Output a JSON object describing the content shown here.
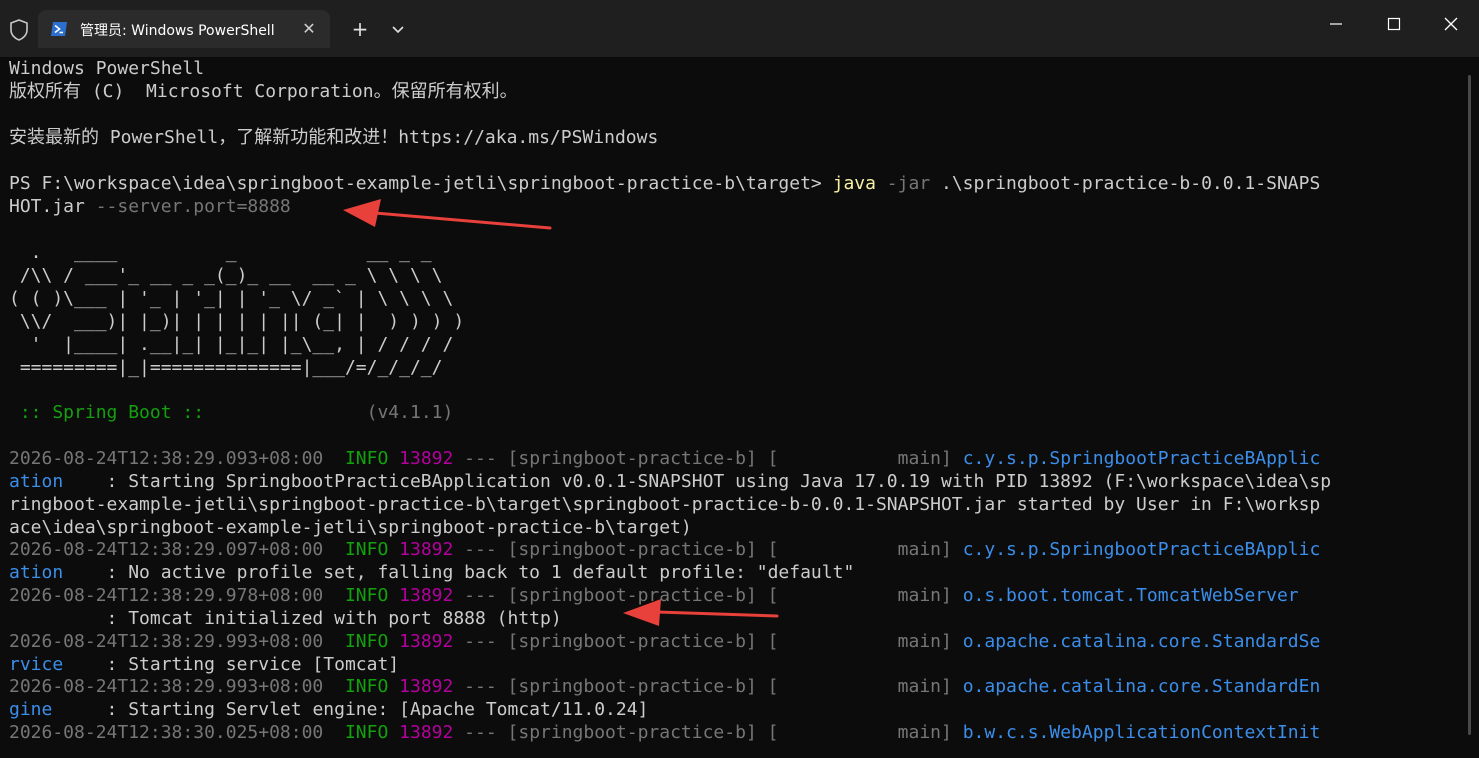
{
  "titlebar": {
    "tab_title": "管理员: Windows PowerShell",
    "close_label": "✕",
    "new_tab_label": "+"
  },
  "terminal": {
    "header": [
      "Windows PowerShell",
      "版权所有 (C)  Microsoft Corporation。保留所有权利。",
      "安装最新的 PowerShell，了解新功能和改进！https://aka.ms/PSWindows"
    ],
    "prompt": {
      "path": "PS F:\\workspace\\idea\\springboot-example-jetli\\springboot-practice-b\\target> ",
      "cmd": "java",
      "flag": " -jar",
      "arg1": " .\\springboot-practice-b-0.0.1-SNAPS",
      "arg1_cont": "HOT.jar",
      "flag2": " --server.port=8888"
    },
    "banner": [
      "  .   ____          _            __ _ _",
      " /\\\\ / ___'_ __ _ _(_)_ __  __ _ \\ \\ \\ \\",
      "( ( )\\___ | '_ | '_| | '_ \\/ _` | \\ \\ \\ \\",
      " \\\\/  ___)| |_)| | | | | || (_| |  ) ) ) )",
      "  '  |____| .__|_| |_|_| |_\\__, | / / / /",
      " =========|_|==============|___/=/_/_/_/"
    ],
    "spring_label": " :: Spring Boot ::",
    "spring_version": "               (v4.1.1)",
    "logs": [
      {
        "time": "2026-08-24T12:38:29.093+08:00",
        "level": "  INFO",
        "pid": " 13892",
        "sep": " --- [springboot-practice-b] [           main] ",
        "logger": "c.y.s.p.SpringbootPracticeBApplic",
        "cont": [
          {
            "logger": "ation",
            "msg": "    : Starting SpringbootPracticeBApplication v0.0.1-SNAPSHOT using Java 17.0.19 with PID 13892 (F:\\workspace\\idea\\sp"
          },
          {
            "logger": "",
            "msg": "ringboot-example-jetli\\springboot-practice-b\\target\\springboot-practice-b-0.0.1-SNAPSHOT.jar started by User in F:\\worksp"
          },
          {
            "logger": "",
            "msg": "ace\\idea\\springboot-example-jetli\\springboot-practice-b\\target)"
          }
        ]
      },
      {
        "time": "2026-08-24T12:38:29.097+08:00",
        "level": "  INFO",
        "pid": " 13892",
        "sep": " --- [springboot-practice-b] [           main] ",
        "logger": "c.y.s.p.SpringbootPracticeBApplic",
        "cont": [
          {
            "logger": "ation",
            "msg": "    : No active profile set, falling back to 1 default profile: \"default\""
          }
        ]
      },
      {
        "time": "2026-08-24T12:38:29.978+08:00",
        "level": "  INFO",
        "pid": " 13892",
        "sep": " --- [springboot-practice-b] [           main] ",
        "logger": "o.s.boot.tomcat.TomcatWebServer",
        "cont": [
          {
            "logger": "",
            "msg": "         : Tomcat initialized with port 8888 (http)"
          }
        ]
      },
      {
        "time": "2026-08-24T12:38:29.993+08:00",
        "level": "  INFO",
        "pid": " 13892",
        "sep": " --- [springboot-practice-b] [           main] ",
        "logger": "o.apache.catalina.core.StandardSe",
        "cont": [
          {
            "logger": "rvice",
            "msg": "    : Starting service [Tomcat]"
          }
        ]
      },
      {
        "time": "2026-08-24T12:38:29.993+08:00",
        "level": "  INFO",
        "pid": " 13892",
        "sep": " --- [springboot-practice-b] [           main] ",
        "logger": "o.apache.catalina.core.StandardEn",
        "cont": [
          {
            "logger": "gine",
            "msg": "     : Starting Servlet engine: [Apache Tomcat/11.0.24]"
          }
        ]
      },
      {
        "time": "2026-08-24T12:38:30.025+08:00",
        "level": "  INFO",
        "pid": " 13892",
        "sep": " --- [springboot-practice-b] [           main] ",
        "logger": "b.w.c.s.WebApplicationContextInit",
        "cont": []
      }
    ]
  },
  "colors": {
    "background": "#0c0c0c",
    "titlebar": "#1f1f1f",
    "annotation_arrow": "#e8403a"
  }
}
